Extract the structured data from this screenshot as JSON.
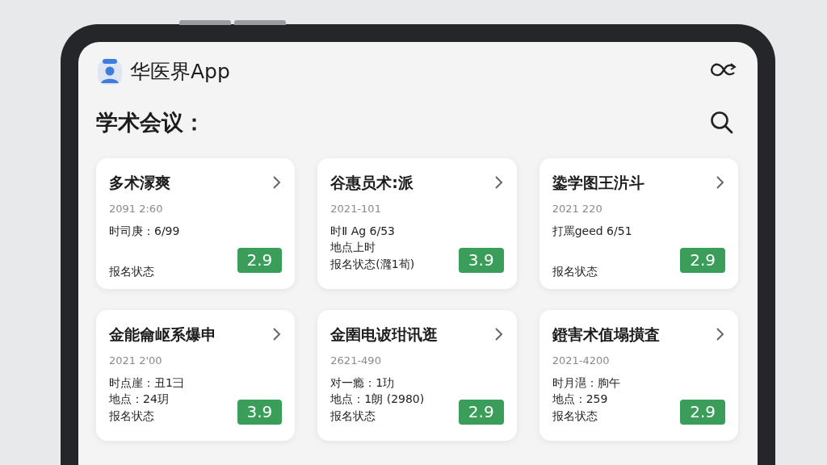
{
  "app_bar": {
    "title": "华医界App"
  },
  "section": {
    "title": "学术会议："
  },
  "cards": [
    {
      "title": "多术溕爽",
      "date": "2091 2:60",
      "lines": [
        "时司庚：6/99",
        "报名状态"
      ],
      "badge": "2.9"
    },
    {
      "title": "谷惠员术:派",
      "date": "2021-101",
      "lines": [
        "时Ⅱ Ag 6/53",
        "地点上时",
        "报名状态(漋1荀)"
      ],
      "badge": "3.9"
    },
    {
      "title": "鍌学图王沜斗",
      "date": "2021 220",
      "lines": [
        "打罵geed 6/51",
        "报名状态"
      ],
      "badge": "2.9"
    },
    {
      "title": "金能龠岖系爆申",
      "date": "2021 2'00",
      "lines": [
        "时点崖：丑1彐",
        "地点：24玥",
        "报名状态"
      ],
      "badge": "3.9"
    },
    {
      "title": "金圉电诐玵讯逛",
      "date": "2621-490",
      "lines": [
        "对一瘾：1玏",
        "地点：1朗 (2980)",
        "报名状态"
      ],
      "badge": "2.9"
    },
    {
      "title": "鐙害术值塌撗査",
      "date": "2021-4200",
      "lines": [
        "时月潖：朐午",
        "地点：259",
        "报名状态"
      ],
      "badge": "2.9"
    }
  ]
}
